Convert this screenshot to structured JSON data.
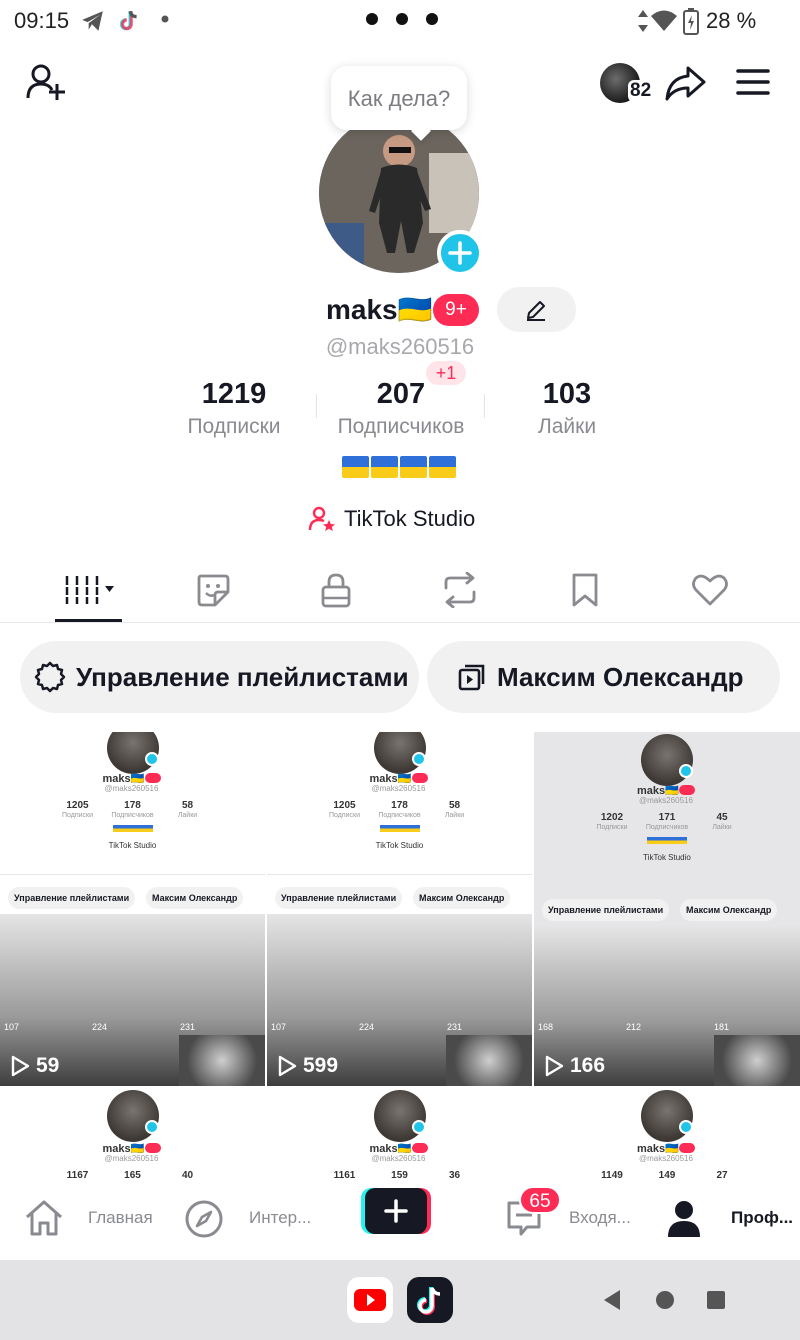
{
  "status_bar": {
    "time": "09:15",
    "battery": "28 %"
  },
  "header": {
    "friends_count": "82"
  },
  "bubble": {
    "text": "Как дела?"
  },
  "profile": {
    "name": "maks🇺🇦",
    "notif_badge": "9+",
    "handle": "@maks260516",
    "followers_delta": "+1",
    "stats": [
      {
        "value": "1219",
        "label": "Подписки"
      },
      {
        "value": "207",
        "label": "Подписчиков"
      },
      {
        "value": "103",
        "label": "Лайки"
      }
    ],
    "studio_label": "TikTok Studio"
  },
  "tabs": [
    {
      "icon": "videos-grid-icon"
    },
    {
      "icon": "sticker-icon"
    },
    {
      "icon": "lock-icon"
    },
    {
      "icon": "repost-icon"
    },
    {
      "icon": "bookmark-icon"
    },
    {
      "icon": "heart-icon"
    }
  ],
  "chips": {
    "playlists": "Управление плейлистами",
    "creator": "Максим Олександр"
  },
  "grid": [
    {
      "views": "59",
      "name": "maks🇺🇦",
      "handle": "@maks260516",
      "stats": [
        "1205",
        "178",
        "58"
      ],
      "labels": [
        "Подписки",
        "Подписчиков",
        "Лайки"
      ],
      "studio": "TikTok Studio",
      "chip1": "Управление плейлистами",
      "chip2": "Максим Олександр",
      "inner_views": [
        "107",
        "224",
        "231"
      ]
    },
    {
      "views": "599",
      "name": "maks🇺🇦",
      "handle": "@maks260516",
      "stats": [
        "1205",
        "178",
        "58"
      ],
      "labels": [
        "Подписки",
        "Подписчиков",
        "Лайки"
      ],
      "studio": "TikTok Studio",
      "chip1": "Управление плейлистами",
      "chip2": "Максим Олександр",
      "inner_views": [
        "107",
        "224",
        "231"
      ]
    },
    {
      "views": "166",
      "name": "maks🇺🇦",
      "handle": "@maks260516",
      "stats": [
        "1202",
        "171",
        "45"
      ],
      "labels": [
        "Подписки",
        "Подписчиков",
        "Лайки"
      ],
      "studio": "TikTok Studio",
      "chip1": "Управление плейлистами",
      "chip2": "Максим Олександр",
      "inner_views": [
        "168",
        "212",
        "181"
      ]
    },
    {
      "name": "maks🇺🇦",
      "handle": "@maks260516",
      "stats": [
        "1167",
        "165",
        "40"
      ]
    },
    {
      "name": "maks🇺🇦",
      "handle": "@maks260516",
      "stats": [
        "1161",
        "159",
        "36"
      ]
    },
    {
      "name": "maks🇺🇦",
      "handle": "@maks260516",
      "stats": [
        "1149",
        "149",
        "27"
      ]
    }
  ],
  "bottom_nav": {
    "home": "Главная",
    "explore": "Интер...",
    "inbox": "Входя...",
    "inbox_badge": "65",
    "profile": "Проф..."
  },
  "colors": {
    "accent": "#fe2c55",
    "cyan": "#20c4e8",
    "text": "#161823"
  }
}
